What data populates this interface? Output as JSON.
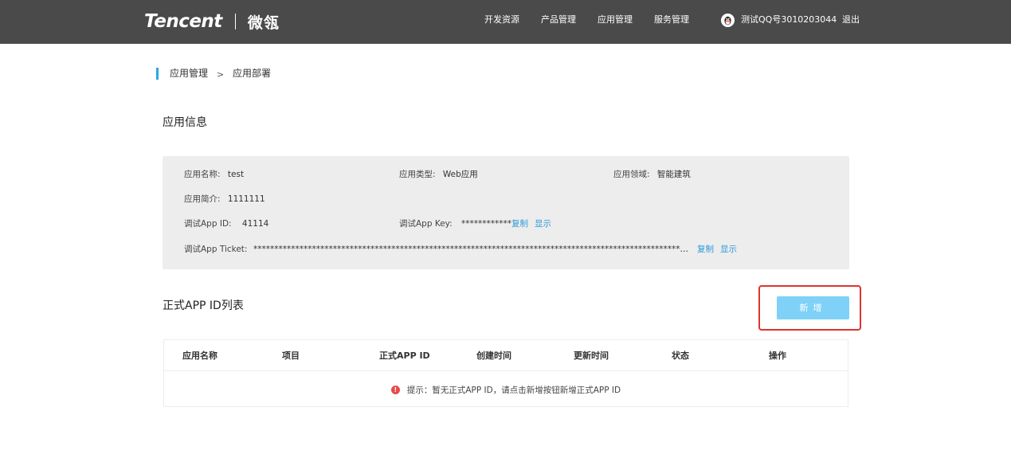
{
  "header": {
    "logo_text": "Tencent",
    "product_name": "微瓴",
    "nav": [
      "开发资源",
      "产品管理",
      "应用管理",
      "服务管理"
    ],
    "user_name": "测试QQ号3010203044",
    "logout_label": "退出"
  },
  "breadcrumb": {
    "parent": "应用管理",
    "separator": ">",
    "current": "应用部署"
  },
  "app_info": {
    "section_title": "应用信息",
    "name_label": "应用名称:",
    "name_value": "test",
    "type_label": "应用类型:",
    "type_value": "Web应用",
    "domain_label": "应用领域:",
    "domain_value": "智能建筑",
    "intro_label": "应用简介:",
    "intro_value": "1111111",
    "debug_app_id_label": "调试App ID:",
    "debug_app_id_value": "41114",
    "debug_app_key_label": "调试App Key:",
    "debug_app_key_value": "************",
    "debug_app_ticket_label": "调试App Ticket:",
    "debug_app_ticket_value": "********************************************************************************************************************************************",
    "copy_label": "复制",
    "show_label": "显示"
  },
  "formal_list": {
    "section_title": "正式APP ID列表",
    "add_button_label": "新增",
    "columns": [
      "应用名称",
      "项目",
      "正式APP ID",
      "创建时间",
      "更新时间",
      "状态",
      "操作"
    ],
    "empty_icon": "warning-icon",
    "empty_text": "提示：暂无正式APP ID，请点击新增按钮新增正式APP ID"
  },
  "colors": {
    "header_bg": "#4a4a4a",
    "accent": "#29a8e0",
    "link": "#2d9ad9",
    "button_bg": "#7fd1f7",
    "highlight": "#e0332e",
    "warning": "#e64b4b"
  }
}
